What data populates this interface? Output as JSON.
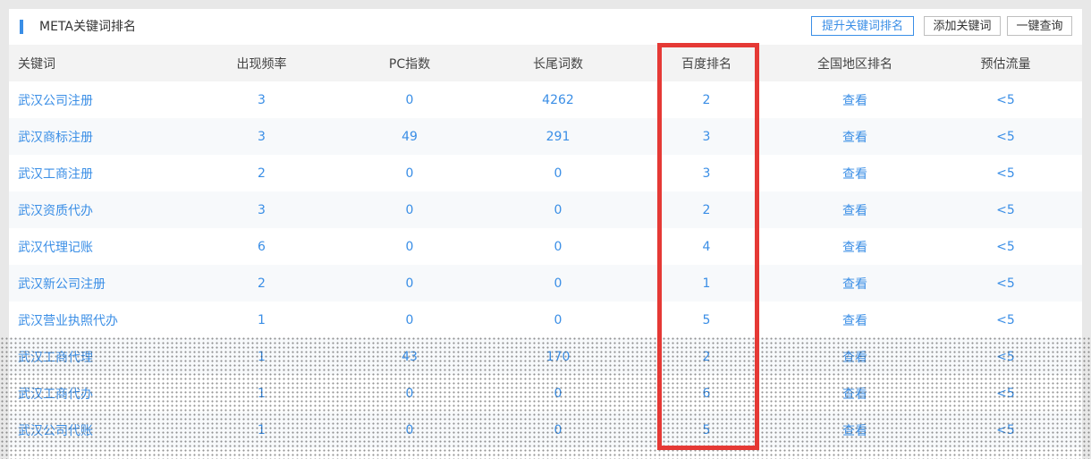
{
  "panel": {
    "title": "META关键词排名",
    "buttons": {
      "improve": "提升关键词排名",
      "add": "添加关键词",
      "query": "一键查询"
    }
  },
  "table": {
    "columns": [
      "关键词",
      "出现频率",
      "PC指数",
      "长尾词数",
      "百度排名",
      "全国地区排名",
      "预估流量"
    ],
    "rows": [
      {
        "keyword": "武汉公司注册",
        "frequency": "3",
        "pc_index": "0",
        "long_tail": "4262",
        "baidu_rank": "2",
        "region_rank": "查看",
        "traffic": "<5"
      },
      {
        "keyword": "武汉商标注册",
        "frequency": "3",
        "pc_index": "49",
        "long_tail": "291",
        "baidu_rank": "3",
        "region_rank": "查看",
        "traffic": "<5"
      },
      {
        "keyword": "武汉工商注册",
        "frequency": "2",
        "pc_index": "0",
        "long_tail": "0",
        "baidu_rank": "3",
        "region_rank": "查看",
        "traffic": "<5"
      },
      {
        "keyword": "武汉资质代办",
        "frequency": "3",
        "pc_index": "0",
        "long_tail": "0",
        "baidu_rank": "2",
        "region_rank": "查看",
        "traffic": "<5"
      },
      {
        "keyword": "武汉代理记账",
        "frequency": "6",
        "pc_index": "0",
        "long_tail": "0",
        "baidu_rank": "4",
        "region_rank": "查看",
        "traffic": "<5"
      },
      {
        "keyword": "武汉新公司注册",
        "frequency": "2",
        "pc_index": "0",
        "long_tail": "0",
        "baidu_rank": "1",
        "region_rank": "查看",
        "traffic": "<5"
      },
      {
        "keyword": "武汉营业执照代办",
        "frequency": "1",
        "pc_index": "0",
        "long_tail": "0",
        "baidu_rank": "5",
        "region_rank": "查看",
        "traffic": "<5"
      },
      {
        "keyword": "武汉工商代理",
        "frequency": "1",
        "pc_index": "43",
        "long_tail": "170",
        "baidu_rank": "2",
        "region_rank": "查看",
        "traffic": "<5"
      },
      {
        "keyword": "武汉工商代办",
        "frequency": "1",
        "pc_index": "0",
        "long_tail": "0",
        "baidu_rank": "6",
        "region_rank": "查看",
        "traffic": "<5"
      },
      {
        "keyword": "武汉公司代账",
        "frequency": "1",
        "pc_index": "0",
        "long_tail": "0",
        "baidu_rank": "5",
        "region_rank": "查看",
        "traffic": "<5"
      }
    ]
  },
  "colors": {
    "accent": "#3a8ee6",
    "highlight_box": "#e53935"
  }
}
